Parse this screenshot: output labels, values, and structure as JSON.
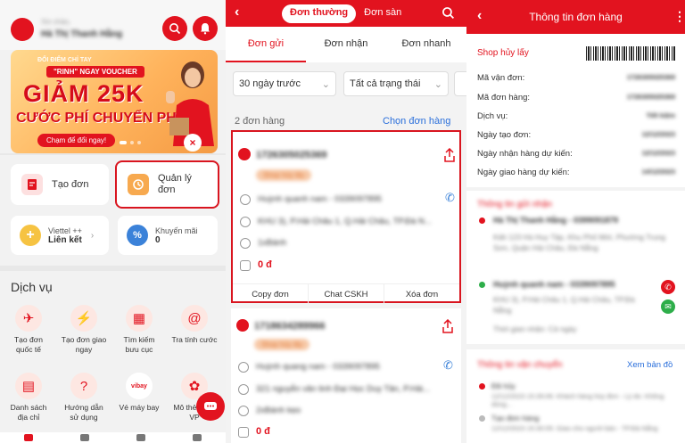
{
  "p1": {
    "greeting": "Xin chào,",
    "user_name": "Hà Thị Thanh Hằng",
    "banner": {
      "top": "ĐỔI ĐIỂM CHỈ TAY",
      "tag": "\"RINH\" NGAY VOUCHER",
      "big": "GIẢM 25K",
      "sub": "CƯỚC PHÍ CHUYỂN PHÁT",
      "cta": "Chạm để đổi ngay!"
    },
    "quick": [
      {
        "label": "Tạo đơn"
      },
      {
        "label": "Quản lý\nđơn"
      }
    ],
    "promo": [
      {
        "line1": "Viettel ++",
        "line2": "Liên kết"
      },
      {
        "line1": "Khuyến mãi",
        "line2": "0"
      }
    ],
    "services_title": "Dịch vụ",
    "services": [
      {
        "label": "Tạo đơn quốc tế",
        "icon": "✈"
      },
      {
        "label": "Tạo đơn giao ngay",
        "icon": "⚡"
      },
      {
        "label": "Tìm kiếm bưu cục",
        "icon": "▦"
      },
      {
        "label": "Tra tính cước",
        "icon": "@"
      },
      {
        "label": "Danh sách địa chỉ",
        "icon": "▤"
      },
      {
        "label": "Hướng dẫn sử dụng",
        "icon": "?"
      },
      {
        "label": "Vé máy bay",
        "icon": "vibay"
      },
      {
        "label": "Mô thẻ dụng VP",
        "icon": "✿"
      }
    ]
  },
  "p2": {
    "seg": {
      "on": "Đơn thường",
      "off": "Đơn sàn"
    },
    "tabs": [
      "Đơn gửi",
      "Đơn nhận",
      "Đơn nhanh"
    ],
    "filters": [
      "30 ngày trước",
      "Tất cả trạng thái"
    ],
    "count": "2 đơn hàng",
    "select": "Chọn đơn hàng",
    "orders": [
      {
        "code": "1726305025369",
        "status": "Shop hủy lấy",
        "receiver": "Huỳnh quanh nam - 0339097895",
        "addr": "KHU 3), P.Hải Châu 1, Q.Hải Châu, TP.Đà N...",
        "item": "1xBánh",
        "amount": "0 đ"
      },
      {
        "code": "1718634289966",
        "status": "Shop hủy lấy",
        "receiver": "Huỳnh quang nam - 0339097895",
        "addr": "321 nguyễn văn linh Đại Học Duy Tân, P.Hải...",
        "item": "2xBánh kẹo",
        "amount": "0 đ"
      }
    ],
    "actions": [
      "Copy đơn",
      "Chat CSKH",
      "Xóa đơn"
    ]
  },
  "p3": {
    "title": "Thông tin đơn hàng",
    "status": "Shop hủy lấy",
    "fields": [
      {
        "k": "Mã vận đơn:",
        "v": "1726305025369"
      },
      {
        "k": "Mã đơn hàng:",
        "v": "1726305025369"
      },
      {
        "k": "Dịch vụ:",
        "v": "Tiết kiệm"
      },
      {
        "k": "Ngày tạo đơn:",
        "v": "12/12/2023"
      },
      {
        "k": "Ngày nhận hàng dự kiến:",
        "v": "12/12/2023"
      },
      {
        "k": "Ngày giao hàng dự kiến:",
        "v": "14/12/2023"
      }
    ],
    "contact_title": "Thông tin gửi nhận",
    "sender": "Hà Thị Thanh Hằng - 0399091879",
    "sender_addr": "Kiệt 123 Hà Huy Tập, Khu Phố Mới, Phường Trung Sơn, Quận Hải Châu, Đà Nẵng",
    "receiver": "Huỳnh quanh nam - 0339097895",
    "receiver_addr": "KHU 3), P.Hải Châu 1, Q.Hải Châu, TP.Đà Nẵng",
    "time_note": "Thời gian nhận: Cả ngày",
    "ship_title": "Thông tin vận chuyển",
    "map_link": "Xem bản đồ",
    "events": [
      {
        "title": "Đã hủy",
        "desc": "12/12/2023 15:39:06: Khách hàng hủy đơn - Lý do: Không dùng..."
      },
      {
        "title": "Tạo đơn hàng",
        "desc": "12/12/2023 15:30:05: Giao cho người bán - TP.Đà Nẵng"
      }
    ]
  }
}
